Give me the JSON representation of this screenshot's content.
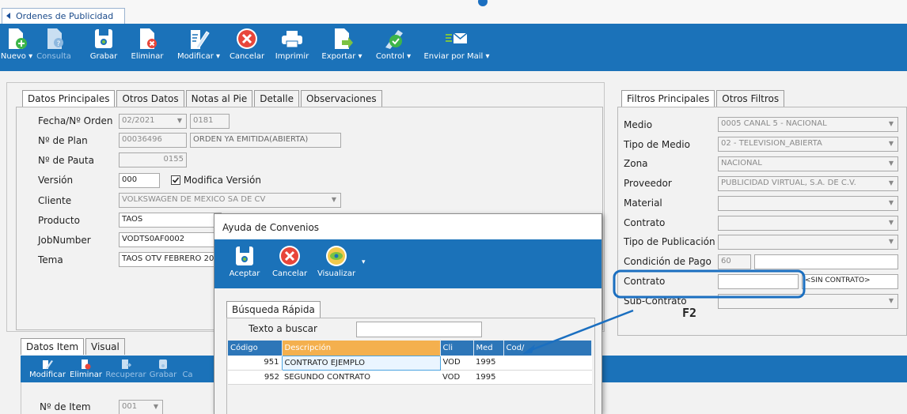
{
  "window": {
    "tab_title": "Ordenes de Publicidad"
  },
  "toolbar": {
    "items": [
      {
        "label": "Nuevo ▾"
      },
      {
        "label": "Consulta"
      },
      {
        "label": "Grabar"
      },
      {
        "label": "Eliminar"
      },
      {
        "label": "Modificar ▾"
      },
      {
        "label": "Cancelar"
      },
      {
        "label": "Imprimir"
      },
      {
        "label": "Exportar ▾"
      },
      {
        "label": "Control ▾"
      },
      {
        "label": "Enviar por Mail ▾"
      }
    ]
  },
  "left_tabs": [
    "Datos Principales",
    "Otros Datos",
    "Notas al Pie",
    "Detalle",
    "Observaciones"
  ],
  "form": {
    "fecha_label": "Fecha/Nº Orden",
    "fecha_value": "02/2021",
    "orden_value": "0181",
    "plan_label": "Nº de Plan",
    "plan_value": "00036496",
    "plan_status": "ORDEN YA EMITIDA(ABIERTA)",
    "pauta_label": "Nº de Pauta",
    "pauta_value": "0155",
    "version_label": "Versión",
    "version_value": "000",
    "modifica_label": "Modifica Versión",
    "cliente_label": "Cliente",
    "cliente_value": "VOLKSWAGEN DE MEXICO SA DE CV",
    "producto_label": "Producto",
    "producto_value": "TAOS",
    "job_label": "JobNumber",
    "job_value": "VODTS0AF0002",
    "tema_label": "Tema",
    "tema_value": "TAOS OTV FEBRERO 202"
  },
  "right_tabs": [
    "Filtros Principales",
    "Otros Filtros"
  ],
  "filters": {
    "medio_label": "Medio",
    "medio_value": "0005 CANAL 5 - NACIONAL",
    "tipo_medio_label": "Tipo de Medio",
    "tipo_medio_value": "02 - TELEVISION_ABIERTA",
    "zona_label": "Zona",
    "zona_value": "NACIONAL",
    "proveedor_label": "Proveedor",
    "proveedor_value": "PUBLICIDAD VIRTUAL, S.A. DE C.V.",
    "material_label": "Material",
    "contrato_label": "Contrato",
    "tipo_pub_label": "Tipo de Publicación",
    "condicion_label": "Condición de Pago",
    "condicion_value": "60",
    "contrato2_label": "Contrato",
    "contrato2_value": "",
    "contrato2_desc": "<SIN CONTRATO>",
    "subcontrato_label": "Sub-Contrato"
  },
  "item_tabs": [
    "Datos Item",
    "Visual"
  ],
  "item_toolbar": [
    "Modificar",
    "Eliminar",
    "Recuperar",
    "Grabar",
    "Ca"
  ],
  "item_form": {
    "item_label": "Nº de Item",
    "item_value": "001"
  },
  "modal": {
    "title": "Ayuda de Convenios",
    "buttons": [
      "Aceptar",
      "Cancelar",
      "Visualizar"
    ],
    "tab": "Búsqueda Rápida",
    "search_label": "Texto a buscar",
    "search_value": "",
    "columns": [
      "Código",
      "Descripción",
      "Cli",
      "Med",
      "Cod/"
    ],
    "rows": [
      {
        "codigo": "951",
        "descripcion": "CONTRATO EJEMPLO",
        "cli": "VOD",
        "med": "1995"
      },
      {
        "codigo": "952",
        "descripcion": "SEGUNDO CONTRATO",
        "cli": "VOD",
        "med": "1995"
      }
    ]
  },
  "annotation": {
    "key_label": "F2",
    "color": "#1b6fc0"
  },
  "colors": {
    "toolbar": "#1b72b9",
    "header": "#2d76b8",
    "highlight_header": "#f4b04e"
  }
}
